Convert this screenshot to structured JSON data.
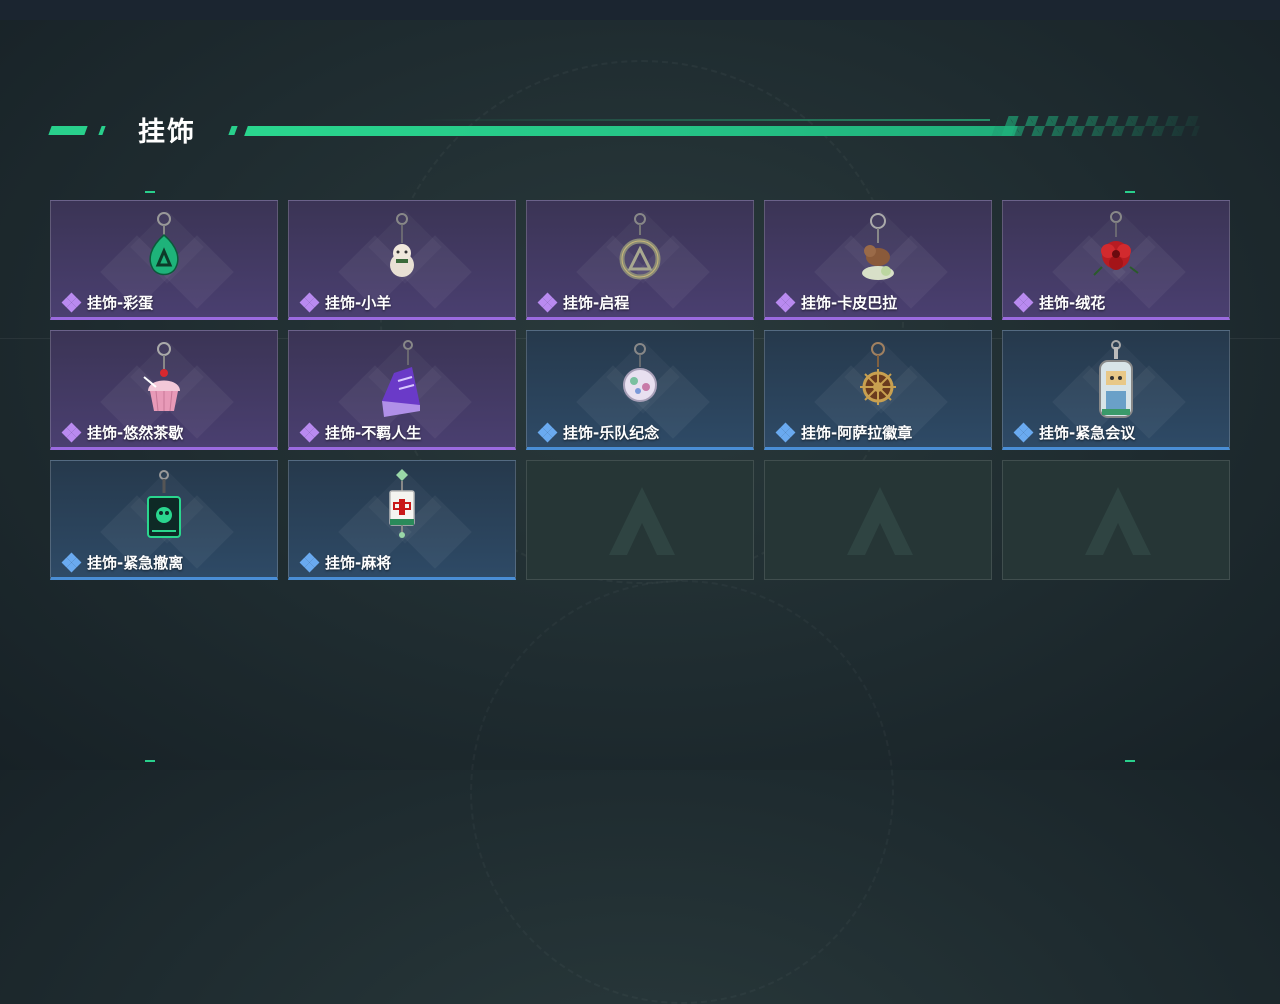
{
  "header": {
    "title": "挂饰"
  },
  "colors": {
    "accent": "#29d08c",
    "epic": "#9b6ae0",
    "rare": "#4a8ed6"
  },
  "items": [
    {
      "label": "挂饰-彩蛋",
      "rarity": "epic",
      "icon": "green-egg-charm-icon"
    },
    {
      "label": "挂饰-小羊",
      "rarity": "epic",
      "icon": "sheep-charm-icon"
    },
    {
      "label": "挂饰-启程",
      "rarity": "epic",
      "icon": "ring-logo-charm-icon"
    },
    {
      "label": "挂饰-卡皮巴拉",
      "rarity": "epic",
      "icon": "capybara-charm-icon"
    },
    {
      "label": "挂饰-绒花",
      "rarity": "epic",
      "icon": "red-flower-charm-icon"
    },
    {
      "label": "挂饰-悠然茶歇",
      "rarity": "epic",
      "icon": "cupcake-charm-icon"
    },
    {
      "label": "挂饰-不羁人生",
      "rarity": "epic",
      "icon": "sneaker-charm-icon"
    },
    {
      "label": "挂饰-乐队纪念",
      "rarity": "rare",
      "icon": "badge-charm-icon"
    },
    {
      "label": "挂饰-阿萨拉徽章",
      "rarity": "rare",
      "icon": "ship-wheel-charm-icon"
    },
    {
      "label": "挂饰-紧急会议",
      "rarity": "rare",
      "icon": "robot-charm-icon"
    },
    {
      "label": "挂饰-紧急撤离",
      "rarity": "rare",
      "icon": "green-box-charm-icon"
    },
    {
      "label": "挂饰-麻将",
      "rarity": "rare",
      "icon": "mahjong-tile-charm-icon"
    }
  ],
  "empty_slots": 3
}
